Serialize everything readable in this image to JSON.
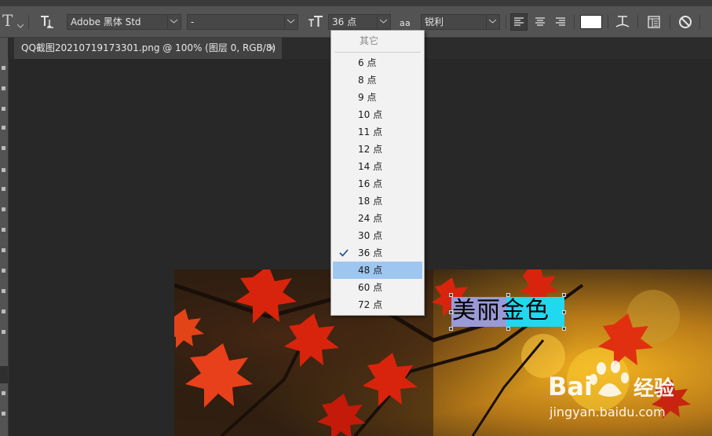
{
  "options_bar": {
    "font_family": "Adobe 黑体 Std",
    "font_style": "-",
    "font_size": "36 点",
    "anti_alias": "锐利",
    "text_color": "#ffffff"
  },
  "document_tab": {
    "title": "QQ截图20210719173301.png @ 100% (图层 0, RGB/8)",
    "close": "×"
  },
  "font_size_menu": {
    "header": "其它",
    "items": [
      "6 点",
      "8 点",
      "9 点",
      "10 点",
      "11 点",
      "12 点",
      "14 点",
      "16 点",
      "18 点",
      "24 点",
      "30 点",
      "36 点",
      "48 点",
      "60 点",
      "72 点"
    ],
    "checked": "36 点",
    "highlighted": "48 点"
  },
  "canvas_text": "美丽金色",
  "watermark": {
    "brand": "Bai",
    "brand_suffix": "经验",
    "url": "jingyan.baidu.com"
  },
  "colors": {
    "accent_highlight": "#9dc7f0",
    "text_select_1": "#9a9ad6",
    "text_select_2": "#20d8f0"
  }
}
